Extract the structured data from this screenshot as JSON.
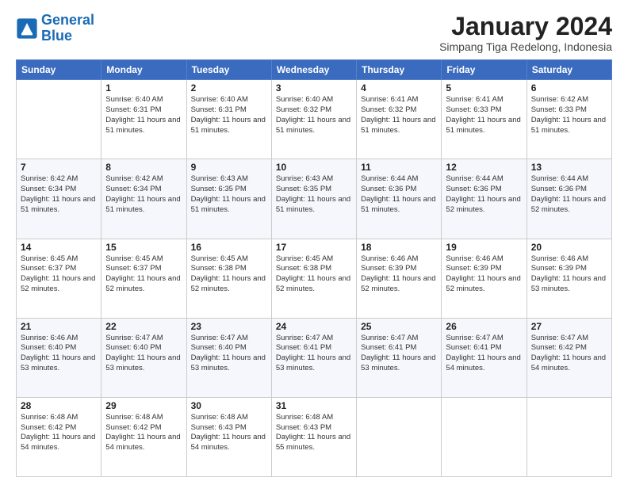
{
  "logo": {
    "general": "General",
    "blue": "Blue"
  },
  "title": "January 2024",
  "subtitle": "Simpang Tiga Redelong, Indonesia",
  "days": [
    "Sunday",
    "Monday",
    "Tuesday",
    "Wednesday",
    "Thursday",
    "Friday",
    "Saturday"
  ],
  "weeks": [
    [
      {
        "day": "",
        "sunrise": "",
        "sunset": "",
        "daylight": ""
      },
      {
        "day": "1",
        "sunrise": "Sunrise: 6:40 AM",
        "sunset": "Sunset: 6:31 PM",
        "daylight": "Daylight: 11 hours and 51 minutes."
      },
      {
        "day": "2",
        "sunrise": "Sunrise: 6:40 AM",
        "sunset": "Sunset: 6:31 PM",
        "daylight": "Daylight: 11 hours and 51 minutes."
      },
      {
        "day": "3",
        "sunrise": "Sunrise: 6:40 AM",
        "sunset": "Sunset: 6:32 PM",
        "daylight": "Daylight: 11 hours and 51 minutes."
      },
      {
        "day": "4",
        "sunrise": "Sunrise: 6:41 AM",
        "sunset": "Sunset: 6:32 PM",
        "daylight": "Daylight: 11 hours and 51 minutes."
      },
      {
        "day": "5",
        "sunrise": "Sunrise: 6:41 AM",
        "sunset": "Sunset: 6:33 PM",
        "daylight": "Daylight: 11 hours and 51 minutes."
      },
      {
        "day": "6",
        "sunrise": "Sunrise: 6:42 AM",
        "sunset": "Sunset: 6:33 PM",
        "daylight": "Daylight: 11 hours and 51 minutes."
      }
    ],
    [
      {
        "day": "7",
        "sunrise": "Sunrise: 6:42 AM",
        "sunset": "Sunset: 6:34 PM",
        "daylight": "Daylight: 11 hours and 51 minutes."
      },
      {
        "day": "8",
        "sunrise": "Sunrise: 6:42 AM",
        "sunset": "Sunset: 6:34 PM",
        "daylight": "Daylight: 11 hours and 51 minutes."
      },
      {
        "day": "9",
        "sunrise": "Sunrise: 6:43 AM",
        "sunset": "Sunset: 6:35 PM",
        "daylight": "Daylight: 11 hours and 51 minutes."
      },
      {
        "day": "10",
        "sunrise": "Sunrise: 6:43 AM",
        "sunset": "Sunset: 6:35 PM",
        "daylight": "Daylight: 11 hours and 51 minutes."
      },
      {
        "day": "11",
        "sunrise": "Sunrise: 6:44 AM",
        "sunset": "Sunset: 6:36 PM",
        "daylight": "Daylight: 11 hours and 51 minutes."
      },
      {
        "day": "12",
        "sunrise": "Sunrise: 6:44 AM",
        "sunset": "Sunset: 6:36 PM",
        "daylight": "Daylight: 11 hours and 52 minutes."
      },
      {
        "day": "13",
        "sunrise": "Sunrise: 6:44 AM",
        "sunset": "Sunset: 6:36 PM",
        "daylight": "Daylight: 11 hours and 52 minutes."
      }
    ],
    [
      {
        "day": "14",
        "sunrise": "Sunrise: 6:45 AM",
        "sunset": "Sunset: 6:37 PM",
        "daylight": "Daylight: 11 hours and 52 minutes."
      },
      {
        "day": "15",
        "sunrise": "Sunrise: 6:45 AM",
        "sunset": "Sunset: 6:37 PM",
        "daylight": "Daylight: 11 hours and 52 minutes."
      },
      {
        "day": "16",
        "sunrise": "Sunrise: 6:45 AM",
        "sunset": "Sunset: 6:38 PM",
        "daylight": "Daylight: 11 hours and 52 minutes."
      },
      {
        "day": "17",
        "sunrise": "Sunrise: 6:45 AM",
        "sunset": "Sunset: 6:38 PM",
        "daylight": "Daylight: 11 hours and 52 minutes."
      },
      {
        "day": "18",
        "sunrise": "Sunrise: 6:46 AM",
        "sunset": "Sunset: 6:39 PM",
        "daylight": "Daylight: 11 hours and 52 minutes."
      },
      {
        "day": "19",
        "sunrise": "Sunrise: 6:46 AM",
        "sunset": "Sunset: 6:39 PM",
        "daylight": "Daylight: 11 hours and 52 minutes."
      },
      {
        "day": "20",
        "sunrise": "Sunrise: 6:46 AM",
        "sunset": "Sunset: 6:39 PM",
        "daylight": "Daylight: 11 hours and 53 minutes."
      }
    ],
    [
      {
        "day": "21",
        "sunrise": "Sunrise: 6:46 AM",
        "sunset": "Sunset: 6:40 PM",
        "daylight": "Daylight: 11 hours and 53 minutes."
      },
      {
        "day": "22",
        "sunrise": "Sunrise: 6:47 AM",
        "sunset": "Sunset: 6:40 PM",
        "daylight": "Daylight: 11 hours and 53 minutes."
      },
      {
        "day": "23",
        "sunrise": "Sunrise: 6:47 AM",
        "sunset": "Sunset: 6:40 PM",
        "daylight": "Daylight: 11 hours and 53 minutes."
      },
      {
        "day": "24",
        "sunrise": "Sunrise: 6:47 AM",
        "sunset": "Sunset: 6:41 PM",
        "daylight": "Daylight: 11 hours and 53 minutes."
      },
      {
        "day": "25",
        "sunrise": "Sunrise: 6:47 AM",
        "sunset": "Sunset: 6:41 PM",
        "daylight": "Daylight: 11 hours and 53 minutes."
      },
      {
        "day": "26",
        "sunrise": "Sunrise: 6:47 AM",
        "sunset": "Sunset: 6:41 PM",
        "daylight": "Daylight: 11 hours and 54 minutes."
      },
      {
        "day": "27",
        "sunrise": "Sunrise: 6:47 AM",
        "sunset": "Sunset: 6:42 PM",
        "daylight": "Daylight: 11 hours and 54 minutes."
      }
    ],
    [
      {
        "day": "28",
        "sunrise": "Sunrise: 6:48 AM",
        "sunset": "Sunset: 6:42 PM",
        "daylight": "Daylight: 11 hours and 54 minutes."
      },
      {
        "day": "29",
        "sunrise": "Sunrise: 6:48 AM",
        "sunset": "Sunset: 6:42 PM",
        "daylight": "Daylight: 11 hours and 54 minutes."
      },
      {
        "day": "30",
        "sunrise": "Sunrise: 6:48 AM",
        "sunset": "Sunset: 6:43 PM",
        "daylight": "Daylight: 11 hours and 54 minutes."
      },
      {
        "day": "31",
        "sunrise": "Sunrise: 6:48 AM",
        "sunset": "Sunset: 6:43 PM",
        "daylight": "Daylight: 11 hours and 55 minutes."
      },
      {
        "day": "",
        "sunrise": "",
        "sunset": "",
        "daylight": ""
      },
      {
        "day": "",
        "sunrise": "",
        "sunset": "",
        "daylight": ""
      },
      {
        "day": "",
        "sunrise": "",
        "sunset": "",
        "daylight": ""
      }
    ]
  ]
}
